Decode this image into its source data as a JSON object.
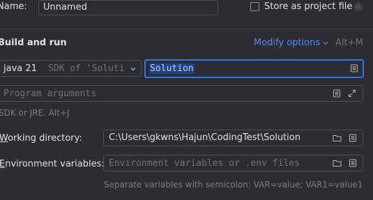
{
  "name_label": "Name:",
  "name_value": "Unnamed",
  "store_as_project_file": {
    "label": "Store as project file",
    "checked": false
  },
  "build_and_run": {
    "title": "Build and run",
    "modify_options": "Modify options",
    "modify_shortcut": "Alt+M",
    "jdk": {
      "version": "java 21",
      "detail": "SDK of 'Soluti"
    },
    "main_class": "Solution",
    "program_arguments_placeholder": "Program arguments",
    "jdk_hint": "SDK or JRE. Alt+J"
  },
  "working_directory": {
    "label_first": "W",
    "label_rest": "orking directory:",
    "value": "C:\\Users\\gkwns\\Hajun\\CodingTest\\Solution"
  },
  "environment_variables": {
    "label_first": "E",
    "label_rest": "nvironment variables:",
    "placeholder": "Environment variables or .env files",
    "hint": "Separate variables with semicolon: VAR=value; VAR1=value1"
  },
  "icons": [
    "gear-icon",
    "chevron-down-icon",
    "document-icon",
    "expand-icon",
    "folder-icon"
  ],
  "colors": {
    "background": "#2b2d30",
    "accent": "#3574f0",
    "link": "#548af7",
    "text": "#dfe1e5",
    "muted": "#6f737a"
  }
}
